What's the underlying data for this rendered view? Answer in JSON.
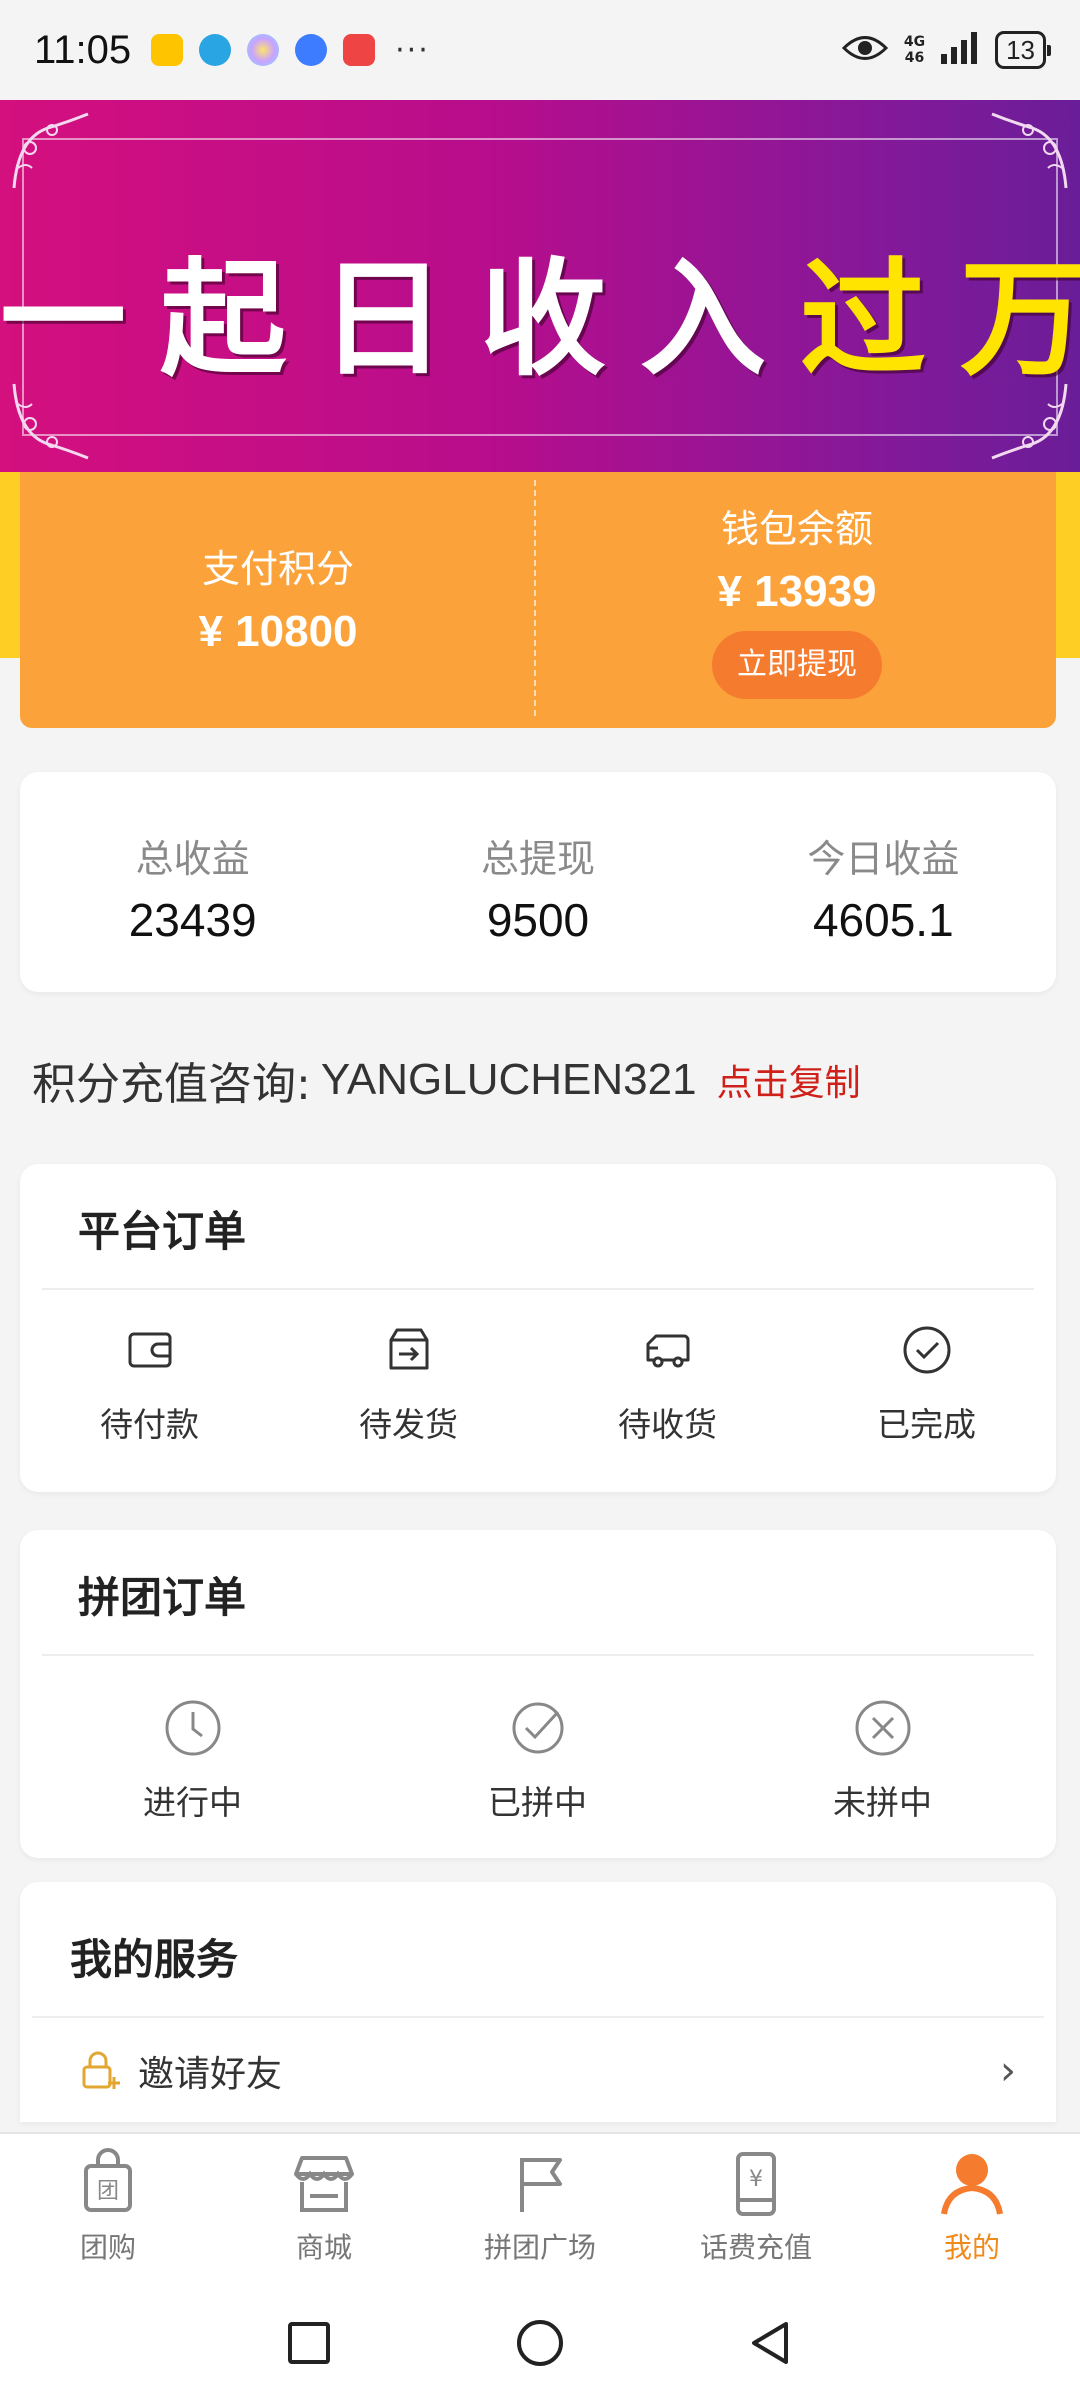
{
  "status_bar": {
    "time": "11:05",
    "network_top": "4G",
    "network_bottom": "46",
    "battery": "13",
    "more": "···",
    "app_icons": [
      "app-a-icon",
      "telegram-icon",
      "photos-icon",
      "music-icon",
      "notes-icon"
    ]
  },
  "banner": {
    "text_main": "一起日收入",
    "text_highlight": "过万",
    "colors": {
      "gradient_start": "#d40f7e",
      "gradient_end": "#6a1d98",
      "highlight": "#ffe400"
    }
  },
  "wallet": {
    "points_label": "支付积分",
    "points_value": "¥ 10800",
    "balance_label": "钱包余额",
    "balance_value": "¥ 13939",
    "withdraw_button": "立即提现",
    "colors": {
      "card": "#fba23a",
      "button": "#f57b2f",
      "band": "#ffce25"
    }
  },
  "stats": [
    {
      "label": "总收益",
      "value": "23439"
    },
    {
      "label": "总提现",
      "value": "9500"
    },
    {
      "label": "今日收益",
      "value": "4605.1"
    }
  ],
  "consult": {
    "label": "积分充值咨询:",
    "id": "YANGLUCHEN321",
    "copy_link": "点击复制"
  },
  "platform_orders": {
    "title": "平台订单",
    "items": [
      {
        "label": "待付款",
        "icon": "wallet-icon"
      },
      {
        "label": "待发货",
        "icon": "ship-box-icon"
      },
      {
        "label": "待收货",
        "icon": "delivery-truck-icon"
      },
      {
        "label": "已完成",
        "icon": "check-circle-icon"
      }
    ]
  },
  "group_orders": {
    "title": "拼团订单",
    "items": [
      {
        "label": "进行中",
        "icon": "clock-icon"
      },
      {
        "label": "已拼中",
        "icon": "check-circle-icon"
      },
      {
        "label": "未拼中",
        "icon": "x-circle-icon"
      }
    ]
  },
  "services": {
    "title": "我的服务",
    "items": [
      {
        "label": "邀请好友",
        "icon": "lock-plus-icon"
      }
    ]
  },
  "tab_bar": {
    "active_color": "#f08a1c",
    "tabs": [
      {
        "label": "团购",
        "icon": "group-buy-bag-icon"
      },
      {
        "label": "商城",
        "icon": "store-icon"
      },
      {
        "label": "拼团广场",
        "icon": "flag-icon"
      },
      {
        "label": "话费充值",
        "icon": "phone-recharge-icon"
      },
      {
        "label": "我的",
        "icon": "person-icon",
        "active": true
      }
    ]
  },
  "system_nav": [
    "recent-apps-icon",
    "home-icon",
    "back-icon"
  ]
}
